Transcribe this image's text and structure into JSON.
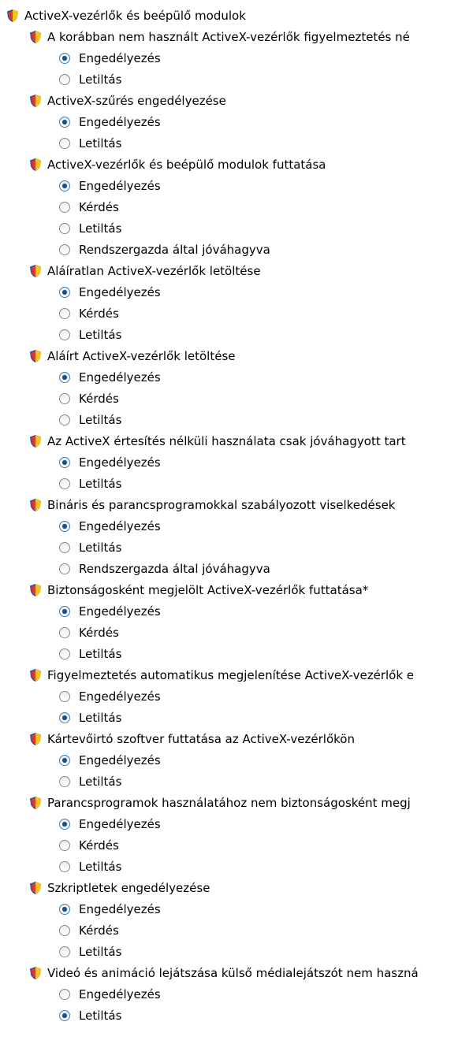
{
  "root": {
    "label": "ActiveX-vezérlők és beépülő modulok",
    "icon": "security-shield-icon"
  },
  "settings": [
    {
      "label": "A korábban nem használt ActiveX-vezérlők figyelmeztetés né",
      "options": [
        {
          "label": "Engedélyezés",
          "checked": true
        },
        {
          "label": "Letiltás",
          "checked": false
        }
      ]
    },
    {
      "label": "ActiveX-szűrés engedélyezése",
      "options": [
        {
          "label": "Engedélyezés",
          "checked": true
        },
        {
          "label": "Letiltás",
          "checked": false
        }
      ]
    },
    {
      "label": "ActiveX-vezérlők és beépülő modulok futtatása",
      "options": [
        {
          "label": "Engedélyezés",
          "checked": true
        },
        {
          "label": "Kérdés",
          "checked": false
        },
        {
          "label": "Letiltás",
          "checked": false
        },
        {
          "label": "Rendszergazda által jóváhagyva",
          "checked": false
        }
      ]
    },
    {
      "label": "Aláíratlan ActiveX-vezérlők letöltése",
      "options": [
        {
          "label": "Engedélyezés",
          "checked": true
        },
        {
          "label": "Kérdés",
          "checked": false
        },
        {
          "label": "Letiltás",
          "checked": false
        }
      ]
    },
    {
      "label": "Aláírt ActiveX-vezérlők letöltése",
      "options": [
        {
          "label": "Engedélyezés",
          "checked": true
        },
        {
          "label": "Kérdés",
          "checked": false
        },
        {
          "label": "Letiltás",
          "checked": false
        }
      ]
    },
    {
      "label": "Az ActiveX értesítés nélküli használata csak jóváhagyott tart",
      "options": [
        {
          "label": "Engedélyezés",
          "checked": true
        },
        {
          "label": "Letiltás",
          "checked": false
        }
      ]
    },
    {
      "label": "Bináris és parancsprogramokkal szabályozott viselkedések",
      "options": [
        {
          "label": "Engedélyezés",
          "checked": true
        },
        {
          "label": "Letiltás",
          "checked": false
        },
        {
          "label": "Rendszergazda által jóváhagyva",
          "checked": false
        }
      ]
    },
    {
      "label": "Biztonságosként megjelölt ActiveX-vezérlők futtatása*",
      "options": [
        {
          "label": "Engedélyezés",
          "checked": true
        },
        {
          "label": "Kérdés",
          "checked": false
        },
        {
          "label": "Letiltás",
          "checked": false
        }
      ]
    },
    {
      "label": "Figyelmeztetés automatikus megjelenítése ActiveX-vezérlők e",
      "options": [
        {
          "label": "Engedélyezés",
          "checked": false
        },
        {
          "label": "Letiltás",
          "checked": true
        }
      ]
    },
    {
      "label": "Kártevőirtó szoftver futtatása az ActiveX-vezérlőkön",
      "options": [
        {
          "label": "Engedélyezés",
          "checked": true
        },
        {
          "label": "Letiltás",
          "checked": false
        }
      ]
    },
    {
      "label": "Parancsprogramok használatához nem biztonságosként megj",
      "options": [
        {
          "label": "Engedélyezés",
          "checked": true
        },
        {
          "label": "Kérdés",
          "checked": false
        },
        {
          "label": "Letiltás",
          "checked": false
        }
      ]
    },
    {
      "label": "Szkriptletek engedélyezése",
      "options": [
        {
          "label": "Engedélyezés",
          "checked": true
        },
        {
          "label": "Kérdés",
          "checked": false
        },
        {
          "label": "Letiltás",
          "checked": false
        }
      ]
    },
    {
      "label": "Videó és animáció lejátszása külső médialejátszót nem haszná",
      "options": [
        {
          "label": "Engedélyezés",
          "checked": false
        },
        {
          "label": "Letiltás",
          "checked": true
        }
      ]
    }
  ]
}
